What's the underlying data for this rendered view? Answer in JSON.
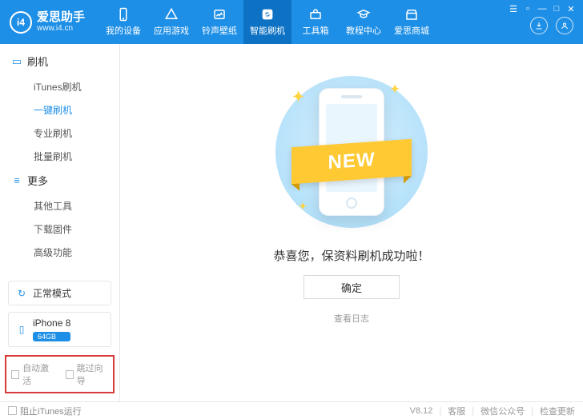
{
  "brand": {
    "title": "爱思助手",
    "url": "www.i4.cn",
    "logo_text": "i4"
  },
  "nav": {
    "items": [
      {
        "label": "我的设备"
      },
      {
        "label": "应用游戏"
      },
      {
        "label": "铃声壁纸"
      },
      {
        "label": "智能刷机"
      },
      {
        "label": "工具箱"
      },
      {
        "label": "教程中心"
      },
      {
        "label": "爱思商城"
      }
    ]
  },
  "sidebar": {
    "flash": {
      "head": "刷机",
      "items": [
        {
          "label": "iTunes刷机"
        },
        {
          "label": "一键刷机"
        },
        {
          "label": "专业刷机"
        },
        {
          "label": "批量刷机"
        }
      ]
    },
    "more": {
      "head": "更多",
      "items": [
        {
          "label": "其他工具"
        },
        {
          "label": "下载固件"
        },
        {
          "label": "高级功能"
        }
      ]
    },
    "mode_card": "正常模式",
    "device": {
      "model": "iPhone 8",
      "capacity": "64GB"
    },
    "checks": {
      "auto_activate": "自动激活",
      "skip_guide": "跳过向导"
    }
  },
  "main": {
    "ribbon": "NEW",
    "success_text": "恭喜您，保资料刷机成功啦！",
    "ok_label": "确定",
    "log_label": "查看日志"
  },
  "footer": {
    "prevent_itunes": "阻止iTunes运行",
    "version": "V8.12",
    "support": "客服",
    "wechat": "微信公众号",
    "check_update": "检查更新"
  }
}
